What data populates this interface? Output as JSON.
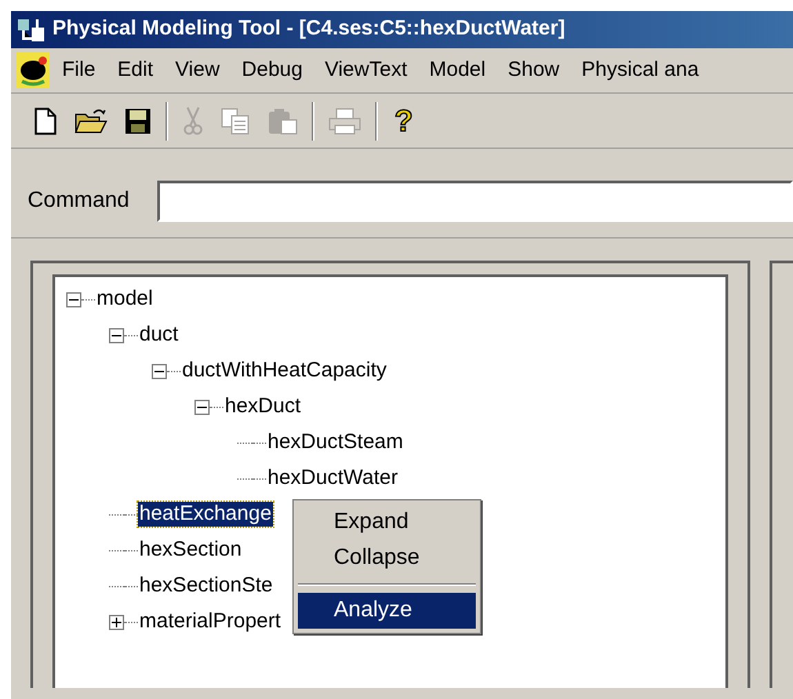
{
  "window": {
    "title": "Physical Modeling Tool - [C4.ses:C5::hexDuctWater]"
  },
  "menu": [
    "File",
    "Edit",
    "View",
    "Debug",
    "ViewText",
    "Model",
    "Show",
    "Physical ana"
  ],
  "toolbar": [
    {
      "kind": "new",
      "disabled": false
    },
    {
      "kind": "open",
      "disabled": false
    },
    {
      "kind": "save",
      "disabled": false
    },
    {
      "kind": "separator"
    },
    {
      "kind": "cut",
      "disabled": true
    },
    {
      "kind": "copy",
      "disabled": true
    },
    {
      "kind": "paste",
      "disabled": true
    },
    {
      "kind": "separator"
    },
    {
      "kind": "print",
      "disabled": true
    },
    {
      "kind": "separator"
    },
    {
      "kind": "help",
      "disabled": false,
      "label": "?"
    }
  ],
  "command": {
    "label": "Command"
  },
  "tree": [
    {
      "label": "model",
      "expanded": true,
      "selected": false,
      "children": [
        {
          "label": "duct",
          "expanded": true,
          "selected": false,
          "children": [
            {
              "label": "ductWithHeatCapacity",
              "expanded": true,
              "selected": false,
              "children": [
                {
                  "label": "hexDuct",
                  "expanded": true,
                  "selected": false,
                  "children": [
                    {
                      "label": "hexDuctSteam",
                      "selected": false
                    },
                    {
                      "label": "hexDuctWater",
                      "selected": false
                    }
                  ]
                }
              ]
            }
          ]
        },
        {
          "label": "heatExchange",
          "selected": true
        },
        {
          "label": "hexSection",
          "selected": false
        },
        {
          "label": "hexSectionSte",
          "selected": false
        },
        {
          "label": "materialPropert",
          "expanded": false,
          "selected": false
        }
      ]
    }
  ],
  "context_menu": [
    {
      "kind": "item",
      "label": "Expand",
      "selected": false
    },
    {
      "kind": "item",
      "label": "Collapse",
      "selected": false
    },
    {
      "kind": "separator"
    },
    {
      "kind": "item",
      "label": "Analyze",
      "selected": true
    }
  ]
}
